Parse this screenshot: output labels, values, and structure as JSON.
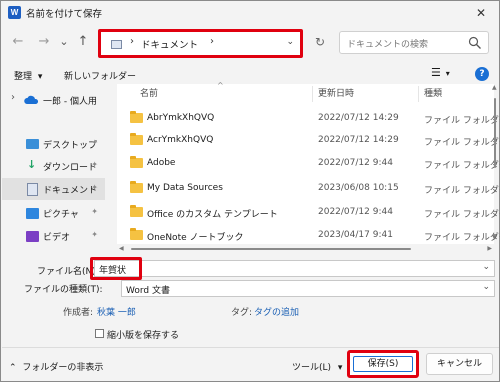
{
  "window": {
    "app_icon": "W",
    "title": "名前を付けて保存",
    "close_glyph": "✕"
  },
  "nav": {
    "back_glyph": "←",
    "forward_glyph": "→",
    "history_glyph": "⌄",
    "up_glyph": "↑",
    "address_sep": "›",
    "address_path": "ドキュメント",
    "address_chevron": "⌄",
    "refresh_glyph": "↻",
    "search_placeholder": "ドキュメントの検索"
  },
  "toolbar": {
    "organize_label": "整理",
    "organize_chevron": "▾",
    "new_folder_label": "新しいフォルダー",
    "view_glyph": "☰",
    "view_chevron": "▾",
    "help_glyph": "?"
  },
  "sidebar": {
    "items": [
      {
        "label": "一郎 - 個人用",
        "icon": "cloud-icon",
        "expand": "›"
      },
      {
        "label": "デスクトップ",
        "icon": "desktop-icon",
        "pin": "📌"
      },
      {
        "label": "ダウンロード",
        "icon": "download-icon",
        "pin": "📌"
      },
      {
        "label": "ドキュメント",
        "icon": "document-icon",
        "pin": "📌"
      },
      {
        "label": "ピクチャ",
        "icon": "pictures-icon",
        "pin": "📌"
      },
      {
        "label": "ビデオ",
        "icon": "video-icon",
        "pin": "📌"
      }
    ]
  },
  "filelist": {
    "sort_glyph": "^",
    "columns": [
      "名前",
      "更新日時",
      "種類"
    ],
    "rows": [
      {
        "name": "AbrYmkXhQVQ",
        "date": "2022/07/12 14:29",
        "type": "ファイル フォルダー"
      },
      {
        "name": "AcrYmkXhQVQ",
        "date": "2022/07/12 14:29",
        "type": "ファイル フォルダー"
      },
      {
        "name": "Adobe",
        "date": "2022/07/12 9:44",
        "type": "ファイル フォルダー"
      },
      {
        "name": "My Data Sources",
        "date": "2023/06/08 10:15",
        "type": "ファイル フォルダー"
      },
      {
        "name": "Office のカスタム テンプレート",
        "date": "2022/07/12 9:44",
        "type": "ファイル フォルダー"
      },
      {
        "name": "OneNote ノートブック",
        "date": "2023/04/17 9:41",
        "type": "ファイル フォルダー"
      }
    ]
  },
  "form": {
    "filename_label": "ファイル名(N):",
    "filename_value": "年賀状",
    "filetype_label": "ファイルの種類(T):",
    "filetype_value": "Word 文書",
    "author_label": "作成者:",
    "author_value": "秋葉 一郎",
    "tags_label": "タグ:",
    "tags_value": "タグの追加",
    "thumbnail_label": "縮小版を保存する",
    "chevron": "⌄"
  },
  "footer": {
    "hide_folders_glyph": "⌃",
    "hide_folders_label": "フォルダーの非表示",
    "tools_label": "ツール(L)",
    "tools_chevron": "▾",
    "save_label": "保存(S)",
    "cancel_label": "キャンセル"
  },
  "colors": {
    "highlight": "#e0000f",
    "accent": "#1a6fd4",
    "folder": "#f5c242"
  }
}
